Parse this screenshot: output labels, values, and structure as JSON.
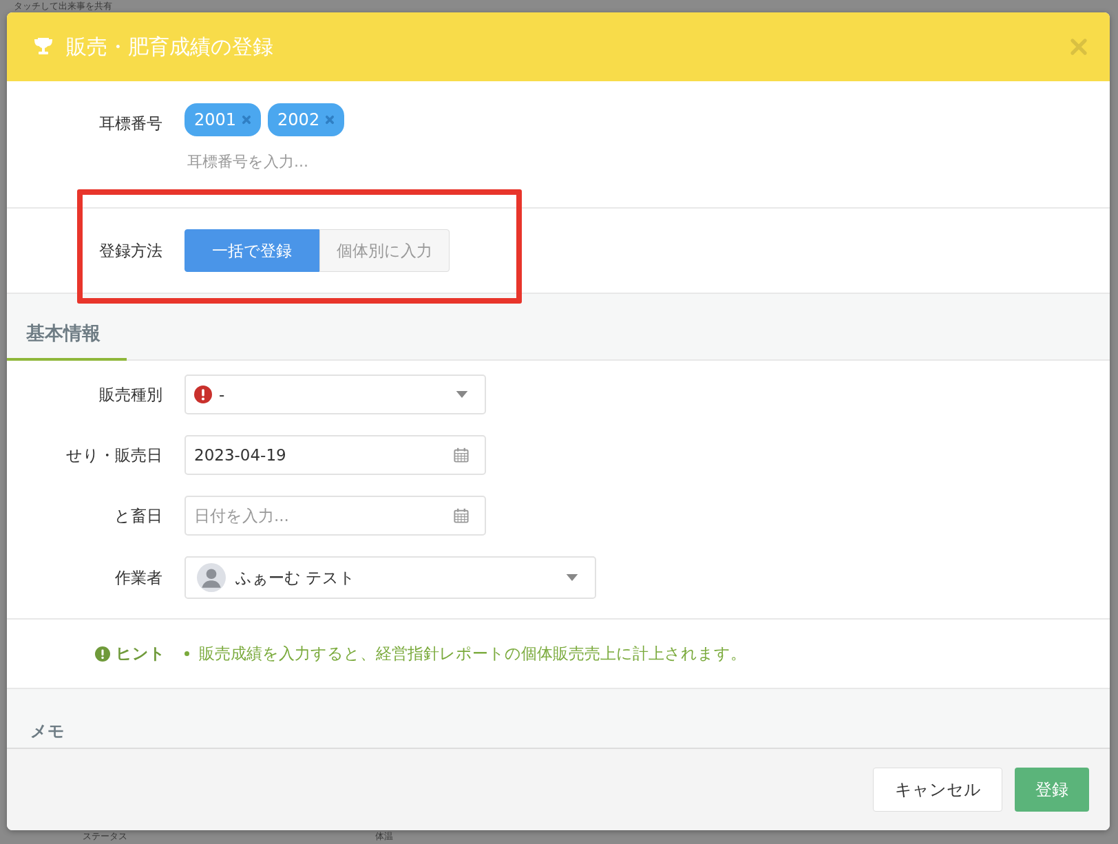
{
  "backdrop": {
    "top_text": "タッチして出来事を共有",
    "bottom_texts": [
      "ステータス",
      "体温"
    ]
  },
  "dialog": {
    "title": "販売・肥育成績の登録"
  },
  "ear_tags": {
    "label": "耳標番号",
    "tags": [
      "2001",
      "2002"
    ],
    "placeholder": "耳標番号を入力..."
  },
  "registration_method": {
    "label": "登録方法",
    "highlighted": true,
    "options": [
      {
        "label": "一括で登録",
        "selected": true
      },
      {
        "label": "個体別に入力",
        "selected": false
      }
    ]
  },
  "basic_info": {
    "title": "基本情報",
    "fields": [
      {
        "kind": "select",
        "label": "販売種別",
        "value": "-",
        "warning": true
      },
      {
        "kind": "date",
        "label": "せり・販売日",
        "value": "2023-04-19"
      },
      {
        "kind": "date",
        "label": "と畜日",
        "placeholder": "日付を入力..."
      },
      {
        "kind": "user-select",
        "label": "作業者",
        "value": "ふぁーむ テスト"
      }
    ]
  },
  "hint": {
    "label": "ヒント",
    "items": [
      "販売成績を入力すると、経営指針レポートの個体販売売上に計上されます。"
    ]
  },
  "memo": {
    "title": "メモ"
  },
  "buttons": [
    {
      "kind": "cancel",
      "label": "キャンセル"
    },
    {
      "kind": "submit",
      "label": "登録"
    }
  ]
}
